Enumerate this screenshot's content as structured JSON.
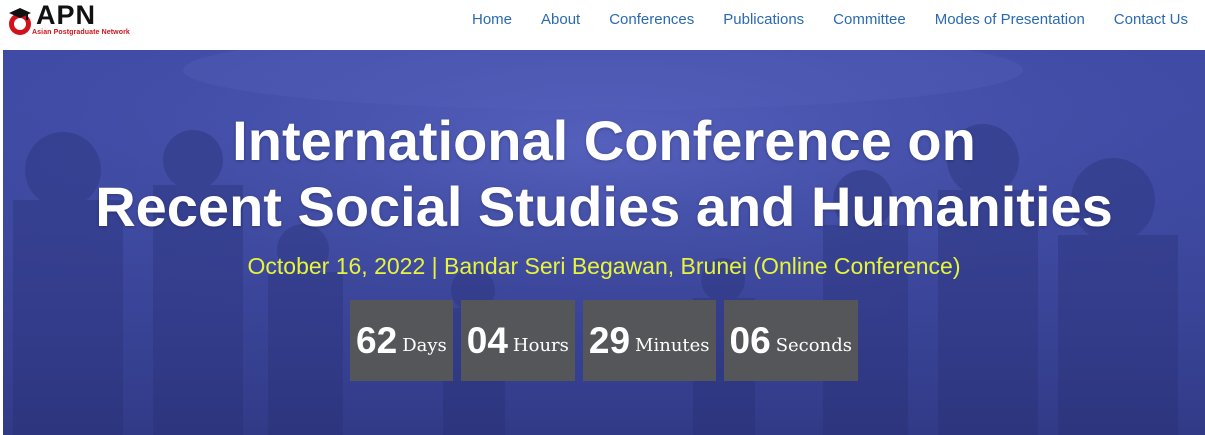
{
  "colors": {
    "nav_link": "#2a6ab2",
    "hero_overlay": "#3e4aa3",
    "subtitle": "#e6f53a",
    "countdown_box": "#555659",
    "logo_red": "#d1121b"
  },
  "header": {
    "logo": {
      "text": "APN",
      "subtitle": "Asian Postgraduate Network"
    },
    "nav": [
      {
        "label": "Home"
      },
      {
        "label": "About"
      },
      {
        "label": "Conferences"
      },
      {
        "label": "Publications"
      },
      {
        "label": "Committee"
      },
      {
        "label": "Modes of Presentation"
      },
      {
        "label": "Contact Us"
      }
    ]
  },
  "hero": {
    "title_line1": "International Conference on",
    "title_line2": "Recent Social Studies and Humanities",
    "subtitle": "October 16, 2022 | Bandar Seri Begawan, Brunei (Online Conference)",
    "countdown": [
      {
        "value": "62",
        "unit": "Days"
      },
      {
        "value": "04",
        "unit": "Hours"
      },
      {
        "value": "29",
        "unit": "Minutes"
      },
      {
        "value": "06",
        "unit": "Seconds"
      }
    ]
  }
}
